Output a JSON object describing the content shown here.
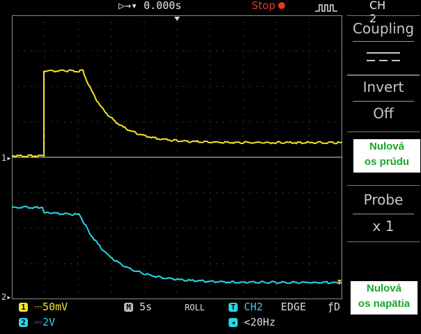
{
  "topbar": {
    "trigger_position": "▷→▾ 0.000s",
    "run_state": "Stop",
    "channel_title": "CH 2"
  },
  "menu": {
    "coupling_label": "Coupling",
    "coupling_value": "DC",
    "invert_label": "Invert",
    "invert_value": "Off",
    "probe_label": "Probe",
    "probe_value": "x 1"
  },
  "annotations": {
    "current_zero": [
      "Nulová",
      "os prúdu"
    ],
    "voltage_zero": [
      "Nulová",
      "os napätia"
    ]
  },
  "status": {
    "ch1_badge": "1",
    "ch1_scale": "50mV",
    "ch2_badge": "2",
    "ch2_scale": "2V",
    "timebase_badge": "M",
    "timebase": "5s",
    "mode": "ROLL",
    "trigger_badge": "T",
    "trigger_source": "CH2",
    "trigger_type": "EDGE",
    "trigger_slope": "ƒ",
    "trigger_freq": "<20Hz"
  },
  "markers": {
    "ch1": "1",
    "ch2": "2"
  },
  "colors": {
    "ch1": "#f4e52c",
    "ch2": "#2ad6e6",
    "stop": "#e53a25",
    "annotation_text": "#1aa62b",
    "grid": "#5a5a5a"
  }
}
